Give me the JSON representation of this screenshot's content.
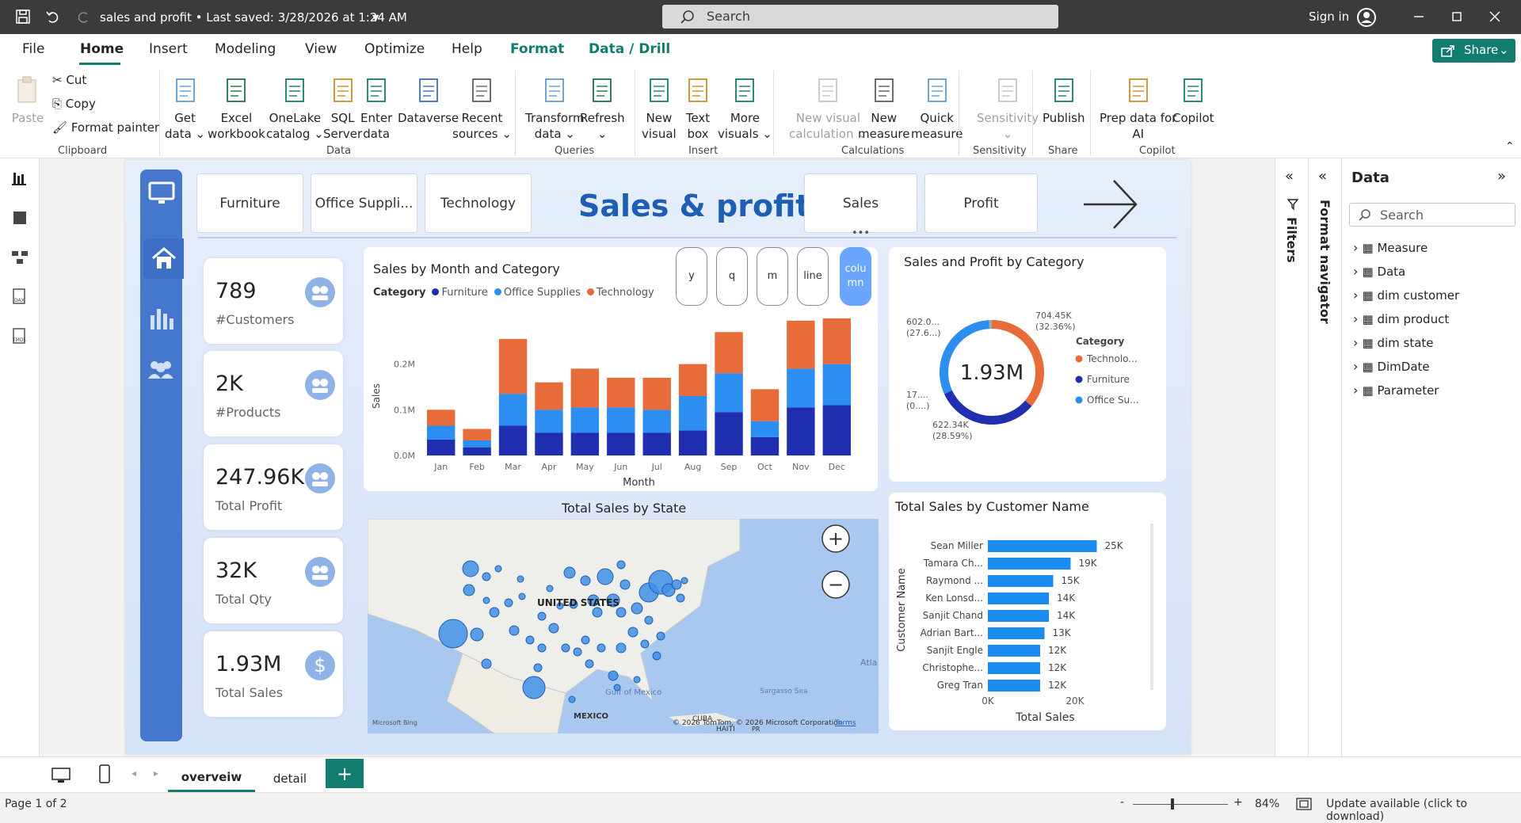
{
  "titlebar": {
    "doc_title": "sales and profit • Last saved: 3/28/2026 at 1:24 AM",
    "search": "Search",
    "signin": "Sign in"
  },
  "menu": {
    "tabs": [
      "File",
      "Home",
      "Insert",
      "Modeling",
      "View",
      "Optimize",
      "Help",
      "Format",
      "Data / Drill"
    ],
    "share": "Share"
  },
  "ribbon": {
    "clipboard": {
      "paste": "Paste",
      "cut": "Cut",
      "copy": "Copy",
      "format_painter": "Format painter",
      "group": "Clipboard"
    },
    "data": {
      "items": [
        [
          "Get",
          "data ⌄"
        ],
        [
          "Excel",
          "workbook"
        ],
        [
          "OneLake",
          "catalog ⌄"
        ],
        [
          "SQL",
          "Server"
        ],
        [
          "Enter",
          "data"
        ],
        [
          "Dataverse",
          ""
        ],
        [
          "Recent",
          "sources ⌄"
        ]
      ],
      "group": "Data"
    },
    "queries": {
      "items": [
        [
          "Transform",
          "data ⌄"
        ],
        [
          "Refresh",
          "⌄"
        ]
      ],
      "group": "Queries"
    },
    "insert": {
      "items": [
        [
          "New",
          "visual"
        ],
        [
          "Text",
          "box"
        ],
        [
          "More",
          "visuals ⌄"
        ]
      ],
      "group": "Insert"
    },
    "calculations": {
      "items": [
        [
          "New visual",
          "calculation ⌄"
        ],
        [
          "New",
          "measure"
        ],
        [
          "Quick",
          "measure"
        ]
      ],
      "group": "Calculations"
    },
    "sensitivity": {
      "items": [
        [
          "Sensitivity",
          "⌄"
        ]
      ],
      "group": "Sensitivity"
    },
    "share": {
      "items": [
        [
          "Publish",
          ""
        ]
      ],
      "group": "Share"
    },
    "copilot": {
      "items": [
        [
          "Prep data for",
          "AI"
        ],
        [
          "Copilot",
          ""
        ]
      ],
      "group": "Copilot"
    }
  },
  "report": {
    "title": "Sales & profit",
    "slicers": [
      "Furniture",
      "Office Suppli...",
      "Technology",
      "Sales",
      "Profit"
    ],
    "kpis": [
      {
        "value": "789",
        "label": "#Customers"
      },
      {
        "value": "2K",
        "label": "#Products"
      },
      {
        "value": "247.96K",
        "label": "Total Profit"
      },
      {
        "value": "32K",
        "label": "Total Qty"
      },
      {
        "value": "1.93M",
        "label": "Total Sales"
      }
    ],
    "toggle_buttons": [
      "y",
      "q",
      "m",
      "line",
      "colu mn"
    ],
    "colors": {
      "furniture": "#1f2fb0",
      "office": "#2b8ef0",
      "technology": "#e86b3a",
      "bar": "#1a8cf0"
    }
  },
  "chart_data": [
    {
      "type": "bar",
      "stacked": true,
      "title": "Sales by Month and Category",
      "legend_title": "Category",
      "xlabel": "Month",
      "ylabel": "Sales",
      "categories": [
        "Jan",
        "Feb",
        "Mar",
        "Apr",
        "May",
        "Jun",
        "Jul",
        "Aug",
        "Sep",
        "Oct",
        "Nov",
        "Dec"
      ],
      "yticks": [
        "0.0M",
        "0.1M",
        "0.2M"
      ],
      "ylim": [
        0,
        0.26
      ],
      "series": [
        {
          "name": "Furniture",
          "values": [
            0.035,
            0.018,
            0.065,
            0.05,
            0.05,
            0.05,
            0.05,
            0.055,
            0.095,
            0.04,
            0.105,
            0.11
          ]
        },
        {
          "name": "Office Supplies",
          "values": [
            0.03,
            0.015,
            0.07,
            0.05,
            0.055,
            0.055,
            0.05,
            0.075,
            0.085,
            0.035,
            0.085,
            0.09
          ]
        },
        {
          "name": "Technology",
          "values": [
            0.035,
            0.025,
            0.12,
            0.06,
            0.085,
            0.065,
            0.07,
            0.07,
            0.09,
            0.07,
            0.105,
            0.1
          ]
        }
      ]
    },
    {
      "type": "pie",
      "donut": true,
      "title": "Sales and Profit by Category",
      "center_label": "1.93M",
      "legend_title": "Category",
      "legend": [
        "Technolo...",
        "Furniture",
        "Office Su..."
      ],
      "slices": [
        {
          "name": "Technology",
          "value": 704.45,
          "label": "704.45K",
          "pct_label": "(32.36%)"
        },
        {
          "name": "Furniture",
          "value": 622.34,
          "label": "622.34K",
          "pct_label": "(28.59%)"
        },
        {
          "name": "Office Supplies",
          "value": 602.0,
          "label": "602.0...",
          "pct_label": "(27.6...)"
        },
        {
          "name": "Other",
          "value": 17,
          "label": "17....",
          "pct_label": "(0....)"
        }
      ]
    },
    {
      "type": "bar",
      "orientation": "horizontal",
      "title": "Total Sales by Customer Name",
      "xlabel": "Total Sales",
      "ylabel": "Customer Name",
      "categories": [
        "Sean Miller",
        "Tamara Ch...",
        "Raymond ...",
        "Ken Lonsd...",
        "Sanjit Chand",
        "Adrian Bart...",
        "Sanjit Engle",
        "Christophe...",
        "Greg Tran"
      ],
      "values": [
        25000,
        19000,
        15000,
        14000,
        14000,
        13000,
        12000,
        12000,
        12000
      ],
      "labels": [
        "25K",
        "19K",
        "15K",
        "14K",
        "14K",
        "13K",
        "12K",
        "12K",
        "12K"
      ],
      "xticks": [
        "0K",
        "20K"
      ],
      "xlim": [
        0,
        30000
      ]
    }
  ],
  "map": {
    "title": "Total Sales by State",
    "country": "UNITED STATES",
    "labels": [
      "Gulf of Mexico",
      "Sargasso Sea",
      "MEXICO",
      "CUBA",
      "HAITI",
      "Atla Oc",
      "PR"
    ],
    "credit": "© 2026 TomTom, © 2026 Microsoft Corporation",
    "terms": "Terms",
    "bing": "Microsoft Bing"
  },
  "panes": {
    "filters": "Filters",
    "format": "Format navigator",
    "data_title": "Data",
    "data_search": "Search",
    "data_items": [
      "Measure",
      "Data",
      "dim customer",
      "dim product",
      "dim state",
      "DimDate",
      "Parameter"
    ]
  },
  "pages": {
    "tabs": [
      "overveiw",
      "detail"
    ],
    "add": "+"
  },
  "status": {
    "page": "Page 1 of 2",
    "zoom": "84%",
    "update": "Update available (click to download)"
  }
}
